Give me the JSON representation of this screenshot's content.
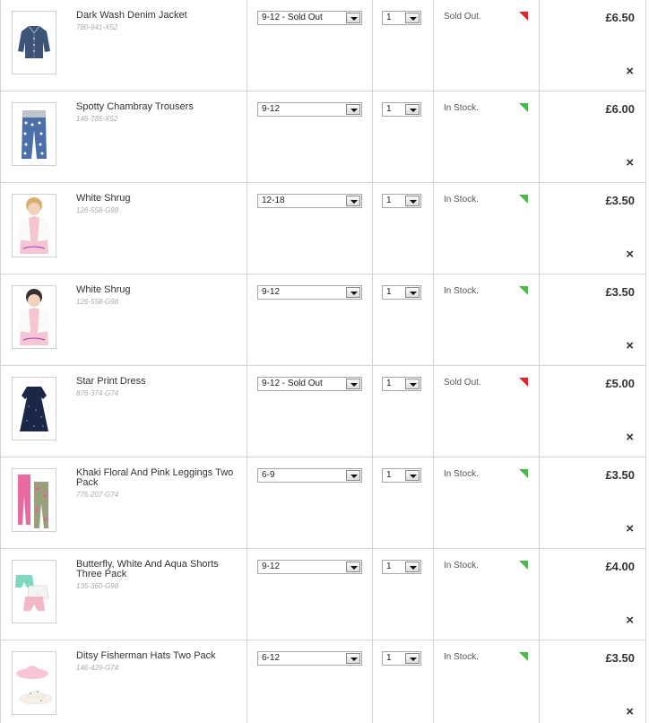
{
  "basket": {
    "remove_icon": "×",
    "items": [
      {
        "name": "Dark Wash Denim Jacket",
        "code": "780-941-X52",
        "size": "9-12 - Sold Out",
        "qty": "1",
        "stock": "Sold Out.",
        "price": "£6.50",
        "image_icon": "denim-jacket-icon",
        "stock_color": "#e0262d"
      },
      {
        "name": "Spotty Chambray Trousers",
        "code": "146-785-X52",
        "size": "9-12",
        "qty": "1",
        "stock": "In Stock.",
        "price": "£6.00",
        "image_icon": "trousers-icon",
        "stock_color": "#4cb84c"
      },
      {
        "name": "White Shrug",
        "code": "126-558-G98",
        "size": "12-18",
        "qty": "1",
        "stock": "In Stock.",
        "price": "£3.50",
        "image_icon": "shrug-icon",
        "stock_color": "#4cb84c"
      },
      {
        "name": "White Shrug",
        "code": "126-558-G98",
        "size": "9-12",
        "qty": "1",
        "stock": "In Stock.",
        "price": "£3.50",
        "image_icon": "shrug-icon",
        "stock_color": "#4cb84c"
      },
      {
        "name": "Star Print Dress",
        "code": "876-374-G74",
        "size": "9-12 - Sold Out",
        "qty": "1",
        "stock": "Sold Out.",
        "price": "£5.00",
        "image_icon": "dress-icon",
        "stock_color": "#e0262d"
      },
      {
        "name": "Khaki Floral And Pink Leggings Two Pack",
        "code": "776-207-G74",
        "size": "6-9",
        "qty": "1",
        "stock": "In Stock.",
        "price": "£3.50",
        "image_icon": "leggings-icon",
        "stock_color": "#4cb84c"
      },
      {
        "name": "Butterfly, White And Aqua Shorts Three Pack",
        "code": "135-360-G98",
        "size": "9-12",
        "qty": "1",
        "stock": "In Stock.",
        "price": "£4.00",
        "image_icon": "shorts-icon",
        "stock_color": "#4cb84c"
      },
      {
        "name": "Ditsy Fisherman Hats Two Pack",
        "code": "146-429-G74",
        "size": "6-12",
        "qty": "1",
        "stock": "In Stock.",
        "price": "£3.50",
        "image_icon": "hat-icon",
        "stock_color": "#4cb84c"
      }
    ]
  }
}
